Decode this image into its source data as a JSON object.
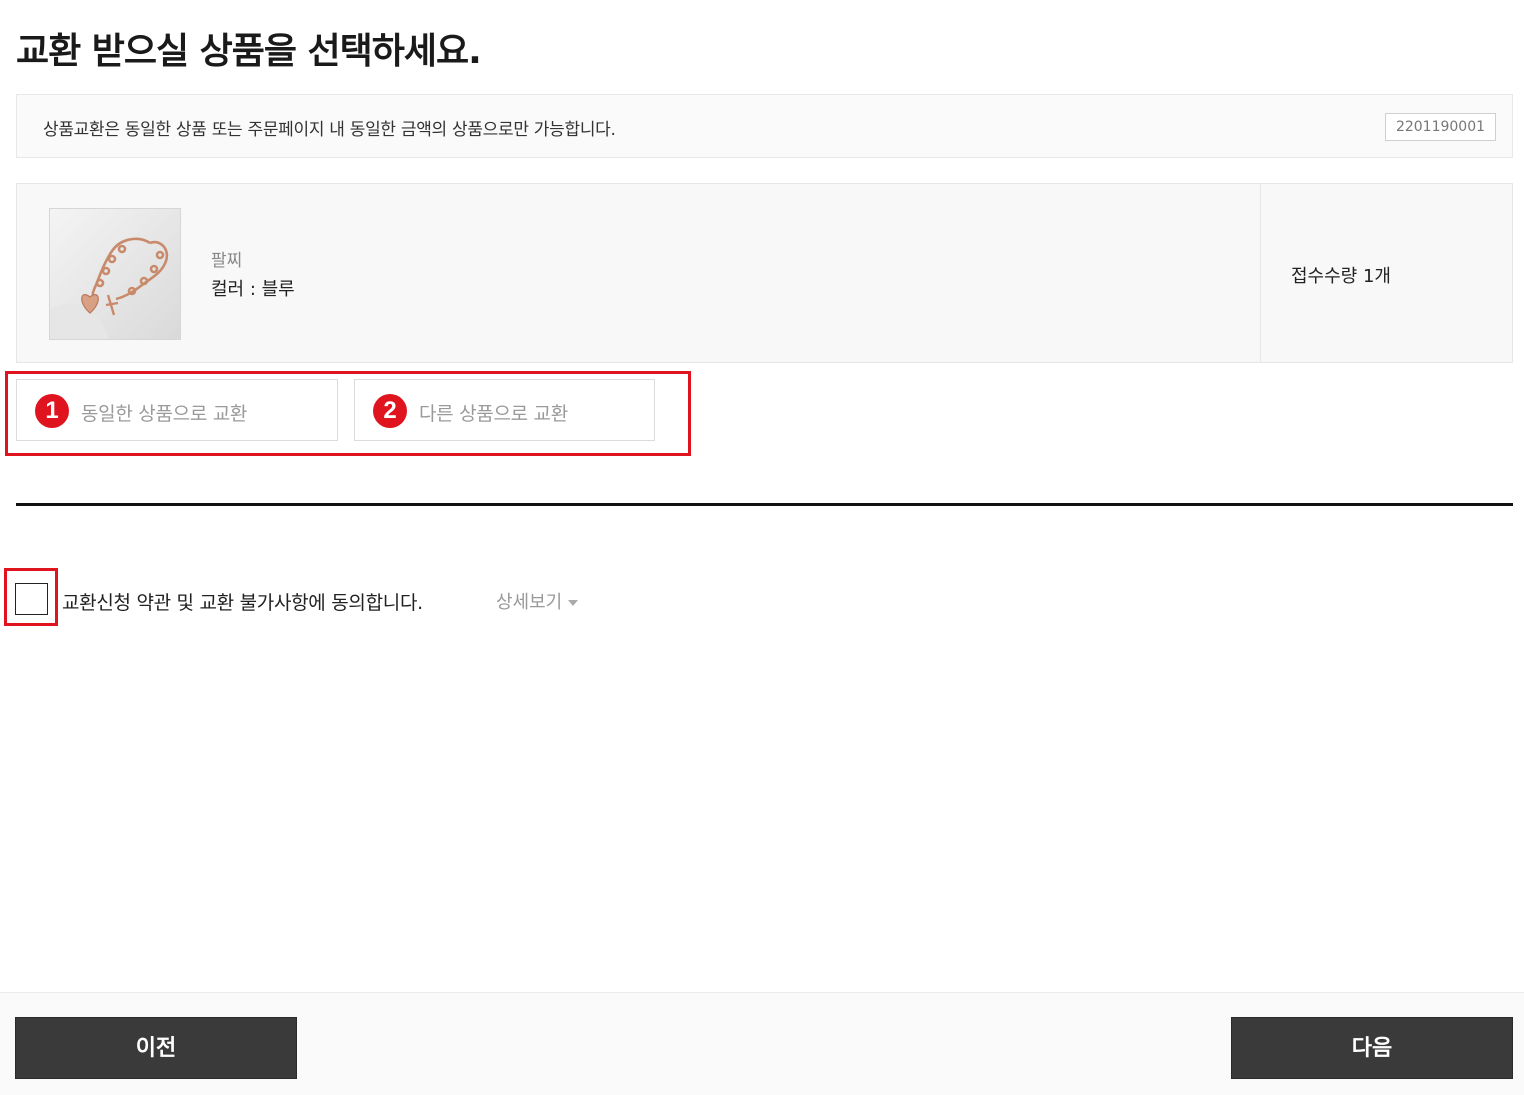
{
  "page": {
    "title": "교환 받으실 상품을 선택하세요."
  },
  "notice": {
    "text": "상품교환은 동일한 상품 또는 주문페이지 내 동일한 금액의 상품으로만 가능합니다.",
    "order_number": "2201190001"
  },
  "product": {
    "name": "팔찌",
    "option": "컬러 : 블루",
    "quantity_label": "접수수량 1개",
    "image_icon": "bracelet-image"
  },
  "exchange_options": [
    {
      "number": "1",
      "label": "동일한 상품으로 교환"
    },
    {
      "number": "2",
      "label": "다른 상품으로 교환"
    }
  ],
  "agreement": {
    "text": "교환신청 약관 및 교환 불가사항에 동의합니다.",
    "detail_link": "상세보기"
  },
  "footer": {
    "prev_label": "이전",
    "next_label": "다음"
  },
  "colors": {
    "accent_red": "#e0141e",
    "button_dark": "#3a3a3a"
  }
}
